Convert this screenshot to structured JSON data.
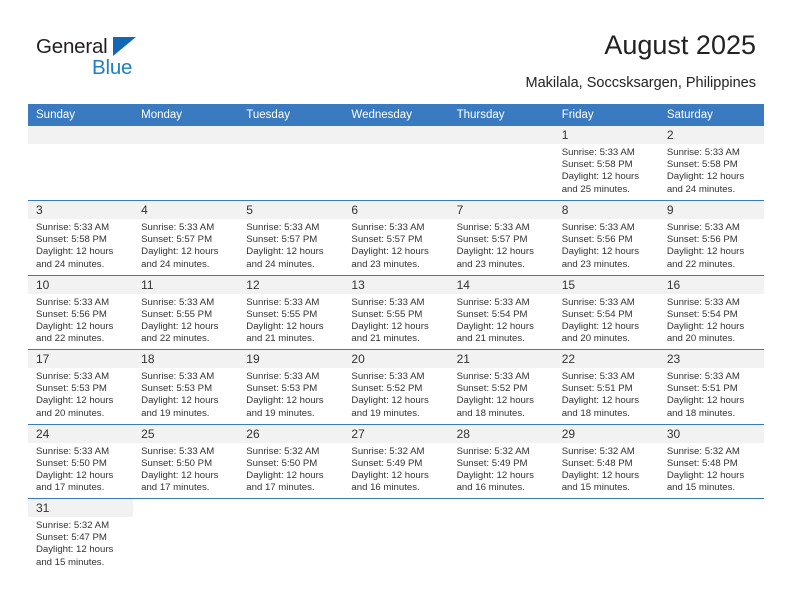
{
  "brand": {
    "name_part1": "General",
    "name_part2": "Blue",
    "triangle_color": "#1266b2",
    "blue_color": "#1f7fc4"
  },
  "header": {
    "title": "August 2025",
    "subtitle": "Makilala, Soccsksargen, Philippines"
  },
  "theme": {
    "header_blue": "#3a7ac0",
    "daynum_gray": "#f2f2f2",
    "text": "#333333"
  },
  "calendar": {
    "weekday_headers": [
      "Sunday",
      "Monday",
      "Tuesday",
      "Wednesday",
      "Thursday",
      "Friday",
      "Saturday"
    ],
    "weeks": [
      [
        {
          "day": "",
          "empty": true
        },
        {
          "day": "",
          "empty": true
        },
        {
          "day": "",
          "empty": true
        },
        {
          "day": "",
          "empty": true
        },
        {
          "day": "",
          "empty": true
        },
        {
          "day": "1",
          "sunrise": "Sunrise: 5:33 AM",
          "sunset": "Sunset: 5:58 PM",
          "daylight": "Daylight: 12 hours and 25 minutes."
        },
        {
          "day": "2",
          "sunrise": "Sunrise: 5:33 AM",
          "sunset": "Sunset: 5:58 PM",
          "daylight": "Daylight: 12 hours and 24 minutes."
        }
      ],
      [
        {
          "day": "3",
          "sunrise": "Sunrise: 5:33 AM",
          "sunset": "Sunset: 5:58 PM",
          "daylight": "Daylight: 12 hours and 24 minutes."
        },
        {
          "day": "4",
          "sunrise": "Sunrise: 5:33 AM",
          "sunset": "Sunset: 5:57 PM",
          "daylight": "Daylight: 12 hours and 24 minutes."
        },
        {
          "day": "5",
          "sunrise": "Sunrise: 5:33 AM",
          "sunset": "Sunset: 5:57 PM",
          "daylight": "Daylight: 12 hours and 24 minutes."
        },
        {
          "day": "6",
          "sunrise": "Sunrise: 5:33 AM",
          "sunset": "Sunset: 5:57 PM",
          "daylight": "Daylight: 12 hours and 23 minutes."
        },
        {
          "day": "7",
          "sunrise": "Sunrise: 5:33 AM",
          "sunset": "Sunset: 5:57 PM",
          "daylight": "Daylight: 12 hours and 23 minutes."
        },
        {
          "day": "8",
          "sunrise": "Sunrise: 5:33 AM",
          "sunset": "Sunset: 5:56 PM",
          "daylight": "Daylight: 12 hours and 23 minutes."
        },
        {
          "day": "9",
          "sunrise": "Sunrise: 5:33 AM",
          "sunset": "Sunset: 5:56 PM",
          "daylight": "Daylight: 12 hours and 22 minutes."
        }
      ],
      [
        {
          "day": "10",
          "sunrise": "Sunrise: 5:33 AM",
          "sunset": "Sunset: 5:56 PM",
          "daylight": "Daylight: 12 hours and 22 minutes."
        },
        {
          "day": "11",
          "sunrise": "Sunrise: 5:33 AM",
          "sunset": "Sunset: 5:55 PM",
          "daylight": "Daylight: 12 hours and 22 minutes."
        },
        {
          "day": "12",
          "sunrise": "Sunrise: 5:33 AM",
          "sunset": "Sunset: 5:55 PM",
          "daylight": "Daylight: 12 hours and 21 minutes."
        },
        {
          "day": "13",
          "sunrise": "Sunrise: 5:33 AM",
          "sunset": "Sunset: 5:55 PM",
          "daylight": "Daylight: 12 hours and 21 minutes."
        },
        {
          "day": "14",
          "sunrise": "Sunrise: 5:33 AM",
          "sunset": "Sunset: 5:54 PM",
          "daylight": "Daylight: 12 hours and 21 minutes."
        },
        {
          "day": "15",
          "sunrise": "Sunrise: 5:33 AM",
          "sunset": "Sunset: 5:54 PM",
          "daylight": "Daylight: 12 hours and 20 minutes."
        },
        {
          "day": "16",
          "sunrise": "Sunrise: 5:33 AM",
          "sunset": "Sunset: 5:54 PM",
          "daylight": "Daylight: 12 hours and 20 minutes."
        }
      ],
      [
        {
          "day": "17",
          "sunrise": "Sunrise: 5:33 AM",
          "sunset": "Sunset: 5:53 PM",
          "daylight": "Daylight: 12 hours and 20 minutes."
        },
        {
          "day": "18",
          "sunrise": "Sunrise: 5:33 AM",
          "sunset": "Sunset: 5:53 PM",
          "daylight": "Daylight: 12 hours and 19 minutes."
        },
        {
          "day": "19",
          "sunrise": "Sunrise: 5:33 AM",
          "sunset": "Sunset: 5:53 PM",
          "daylight": "Daylight: 12 hours and 19 minutes."
        },
        {
          "day": "20",
          "sunrise": "Sunrise: 5:33 AM",
          "sunset": "Sunset: 5:52 PM",
          "daylight": "Daylight: 12 hours and 19 minutes."
        },
        {
          "day": "21",
          "sunrise": "Sunrise: 5:33 AM",
          "sunset": "Sunset: 5:52 PM",
          "daylight": "Daylight: 12 hours and 18 minutes."
        },
        {
          "day": "22",
          "sunrise": "Sunrise: 5:33 AM",
          "sunset": "Sunset: 5:51 PM",
          "daylight": "Daylight: 12 hours and 18 minutes."
        },
        {
          "day": "23",
          "sunrise": "Sunrise: 5:33 AM",
          "sunset": "Sunset: 5:51 PM",
          "daylight": "Daylight: 12 hours and 18 minutes."
        }
      ],
      [
        {
          "day": "24",
          "sunrise": "Sunrise: 5:33 AM",
          "sunset": "Sunset: 5:50 PM",
          "daylight": "Daylight: 12 hours and 17 minutes."
        },
        {
          "day": "25",
          "sunrise": "Sunrise: 5:33 AM",
          "sunset": "Sunset: 5:50 PM",
          "daylight": "Daylight: 12 hours and 17 minutes."
        },
        {
          "day": "26",
          "sunrise": "Sunrise: 5:32 AM",
          "sunset": "Sunset: 5:50 PM",
          "daylight": "Daylight: 12 hours and 17 minutes."
        },
        {
          "day": "27",
          "sunrise": "Sunrise: 5:32 AM",
          "sunset": "Sunset: 5:49 PM",
          "daylight": "Daylight: 12 hours and 16 minutes."
        },
        {
          "day": "28",
          "sunrise": "Sunrise: 5:32 AM",
          "sunset": "Sunset: 5:49 PM",
          "daylight": "Daylight: 12 hours and 16 minutes."
        },
        {
          "day": "29",
          "sunrise": "Sunrise: 5:32 AM",
          "sunset": "Sunset: 5:48 PM",
          "daylight": "Daylight: 12 hours and 15 minutes."
        },
        {
          "day": "30",
          "sunrise": "Sunrise: 5:32 AM",
          "sunset": "Sunset: 5:48 PM",
          "daylight": "Daylight: 12 hours and 15 minutes."
        }
      ],
      [
        {
          "day": "31",
          "sunrise": "Sunrise: 5:32 AM",
          "sunset": "Sunset: 5:47 PM",
          "daylight": "Daylight: 12 hours and 15 minutes."
        },
        {
          "day": "",
          "blank": true
        },
        {
          "day": "",
          "blank": true
        },
        {
          "day": "",
          "blank": true
        },
        {
          "day": "",
          "blank": true
        },
        {
          "day": "",
          "blank": true
        },
        {
          "day": "",
          "blank": true
        }
      ]
    ]
  }
}
